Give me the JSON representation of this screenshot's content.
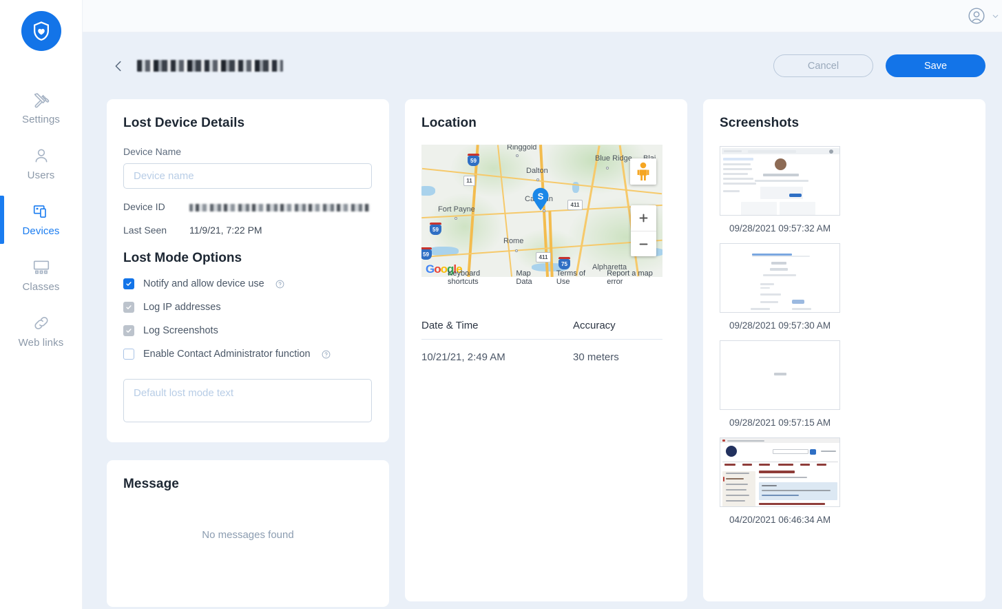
{
  "sidebar": {
    "brand_icon": "shield-heart-logo",
    "items": [
      {
        "label": "Settings",
        "icon": "tools-icon",
        "active": false
      },
      {
        "label": "Users",
        "icon": "user-icon",
        "active": false
      },
      {
        "label": "Devices",
        "icon": "devices-icon",
        "active": true
      },
      {
        "label": "Classes",
        "icon": "classroom-icon",
        "active": false
      },
      {
        "label": "Web links",
        "icon": "link-icon",
        "active": false
      }
    ]
  },
  "topbar": {
    "avatar_icon": "user-avatar-icon",
    "chevron_icon": "chevron-down-icon"
  },
  "header": {
    "back_icon": "back-chevron-icon",
    "title": "",
    "title_redacted": true,
    "cancel_label": "Cancel",
    "save_label": "Save"
  },
  "lost_device": {
    "heading": "Lost Device Details",
    "device_name_label": "Device Name",
    "device_name_value": "",
    "device_name_placeholder": "Device name",
    "device_id_label": "Device ID",
    "device_id_value": "",
    "device_id_redacted": true,
    "last_seen_label": "Last Seen",
    "last_seen_value": "11/9/21, 7:22 PM",
    "options_heading": "Lost Mode Options",
    "options": [
      {
        "label": "Notify and allow device use",
        "state": "on",
        "help": true
      },
      {
        "label": "Log IP addresses",
        "state": "locked",
        "help": false
      },
      {
        "label": "Log Screenshots",
        "state": "locked",
        "help": false
      },
      {
        "label": "Enable Contact Administrator function",
        "state": "off",
        "help": true
      }
    ],
    "lost_text_value": "",
    "lost_text_placeholder": "Default lost mode text"
  },
  "message": {
    "heading": "Message",
    "empty_text": "No messages found"
  },
  "location": {
    "heading": "Location",
    "map": {
      "provider": "Google",
      "marker_letter": "S",
      "pegman_icon": "street-view-pegman-icon",
      "zoom_in_label": "+",
      "zoom_out_label": "−",
      "labels": [
        "Ringgold",
        "Blue Ridge",
        "Blai",
        "Dalton",
        "Fort Payne",
        "Calhoun",
        "Rome",
        "Alpharetta"
      ],
      "route_shields": [
        "59",
        "11",
        "411",
        "59",
        "59",
        "411",
        "75"
      ],
      "attribution": [
        "Keyboard shortcuts",
        "Map Data",
        "Terms of Use",
        "Report a map error"
      ]
    },
    "table": {
      "columns": [
        "Date & Time",
        "Accuracy"
      ],
      "rows": [
        {
          "datetime": "10/21/21, 2:49 AM",
          "accuracy": "30 meters"
        }
      ]
    }
  },
  "screenshots": {
    "heading": "Screenshots",
    "items": [
      {
        "caption": "09/28/2021 09:57:32 AM",
        "kind": "google-account-page"
      },
      {
        "caption": "09/28/2021 09:57:30 AM",
        "kind": "google-signin-page"
      },
      {
        "caption": "09/28/2021 09:57:15 AM",
        "kind": "blank-google-page"
      },
      {
        "caption": "04/20/2021 06:46:34 AM",
        "kind": "american-flag-article"
      }
    ]
  },
  "colors": {
    "accent": "#1374e8",
    "page_bg": "#eaf0f8",
    "card_bg": "#ffffff",
    "muted_text": "#8b9cb0"
  }
}
